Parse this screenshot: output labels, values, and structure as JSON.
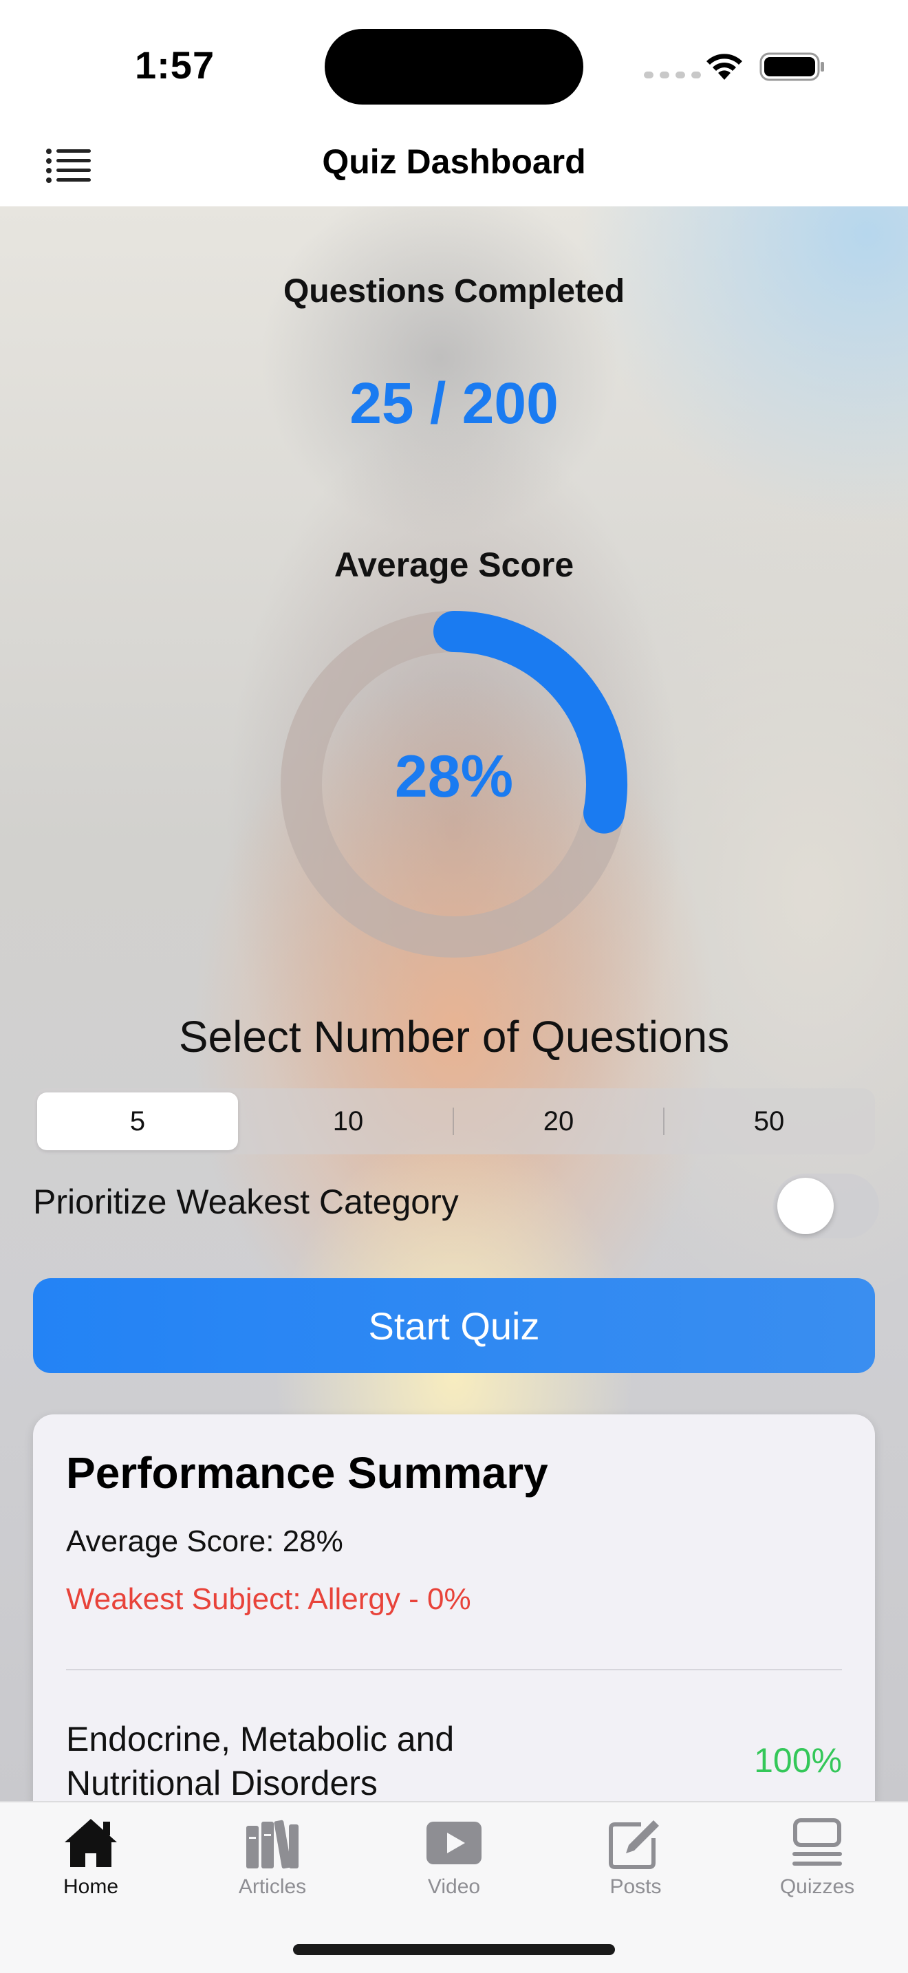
{
  "status_bar": {
    "time": "1:57"
  },
  "nav": {
    "title": "Quiz Dashboard",
    "menu_icon": "list-icon"
  },
  "progress": {
    "label": "Questions Completed",
    "value": "25 / 200",
    "completed": 25,
    "total": 200
  },
  "average": {
    "label": "Average Score",
    "text": "28%",
    "fraction": 0.28
  },
  "question_select": {
    "label": "Select Number of Questions",
    "options": [
      "5",
      "10",
      "20",
      "50"
    ],
    "selected": "5"
  },
  "prioritize": {
    "label": "Prioritize Weakest Category",
    "enabled": false
  },
  "start_button": {
    "label": "Start Quiz"
  },
  "summary": {
    "title": "Performance Summary",
    "average_line": "Average Score: 28%",
    "weakest_line": "Weakest Subject: Allergy - 0%",
    "subjects": [
      {
        "name": "Endocrine, Metabolic and Nutritional Disorders",
        "score": "100%"
      }
    ]
  },
  "tabs": [
    {
      "label": "Home",
      "icon": "house-icon",
      "active": true
    },
    {
      "label": "Articles",
      "icon": "books-icon",
      "active": false
    },
    {
      "label": "Video",
      "icon": "play-rectangle-icon",
      "active": false
    },
    {
      "label": "Posts",
      "icon": "compose-icon",
      "active": false
    },
    {
      "label": "Quizzes",
      "icon": "quiz-list-icon",
      "active": false
    }
  ],
  "colors": {
    "accent": "#1a7bf1",
    "weak": "#e8433a",
    "good": "#34c759",
    "ring_track": "#bdb0ab"
  }
}
